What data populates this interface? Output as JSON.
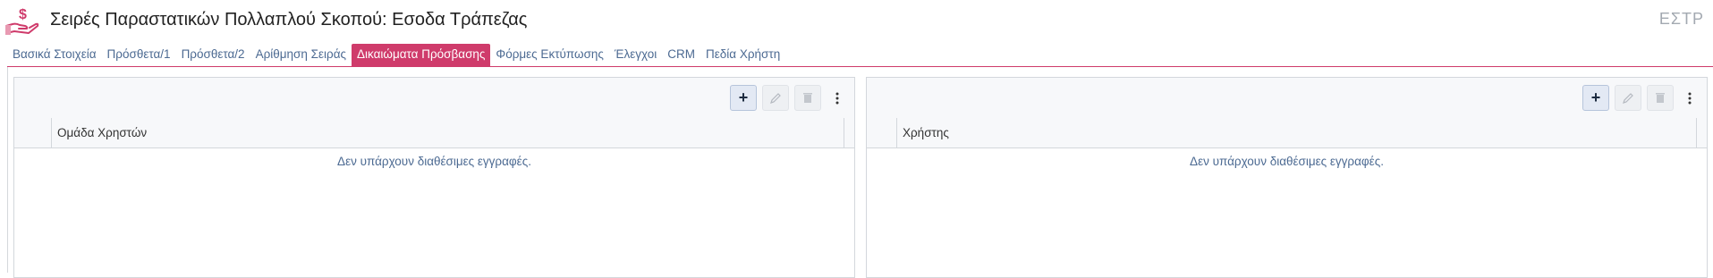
{
  "header": {
    "title": "Σειρές Παραστατικών Πολλαπλού Σκοπού: Εσοδα Τράπεζας",
    "code": "ΕΣΤΡ",
    "logo_icon": "hand-money-icon",
    "accent_color": "#cf3b6b"
  },
  "tabs": [
    {
      "label": "Βασικά Στοιχεία",
      "active": false
    },
    {
      "label": "Πρόσθετα/1",
      "active": false
    },
    {
      "label": "Πρόσθετα/2",
      "active": false
    },
    {
      "label": "Αρίθμηση Σειράς",
      "active": false
    },
    {
      "label": "Δικαιώματα Πρόσβασης",
      "active": true
    },
    {
      "label": "Φόρμες Εκτύπωσης",
      "active": false
    },
    {
      "label": "Έλεγχοι",
      "active": false
    },
    {
      "label": "CRM",
      "active": false
    },
    {
      "label": "Πεδία Χρήστη",
      "active": false
    }
  ],
  "panels": {
    "left": {
      "column_header": "Ομάδα Χρηστών",
      "empty_text": "Δεν υπάρχουν διαθέσιμες εγγραφές.",
      "add_label": "+"
    },
    "right": {
      "column_header": "Χρήστης",
      "empty_text": "Δεν υπάρχουν διαθέσιμες εγγραφές.",
      "add_label": "+"
    }
  }
}
